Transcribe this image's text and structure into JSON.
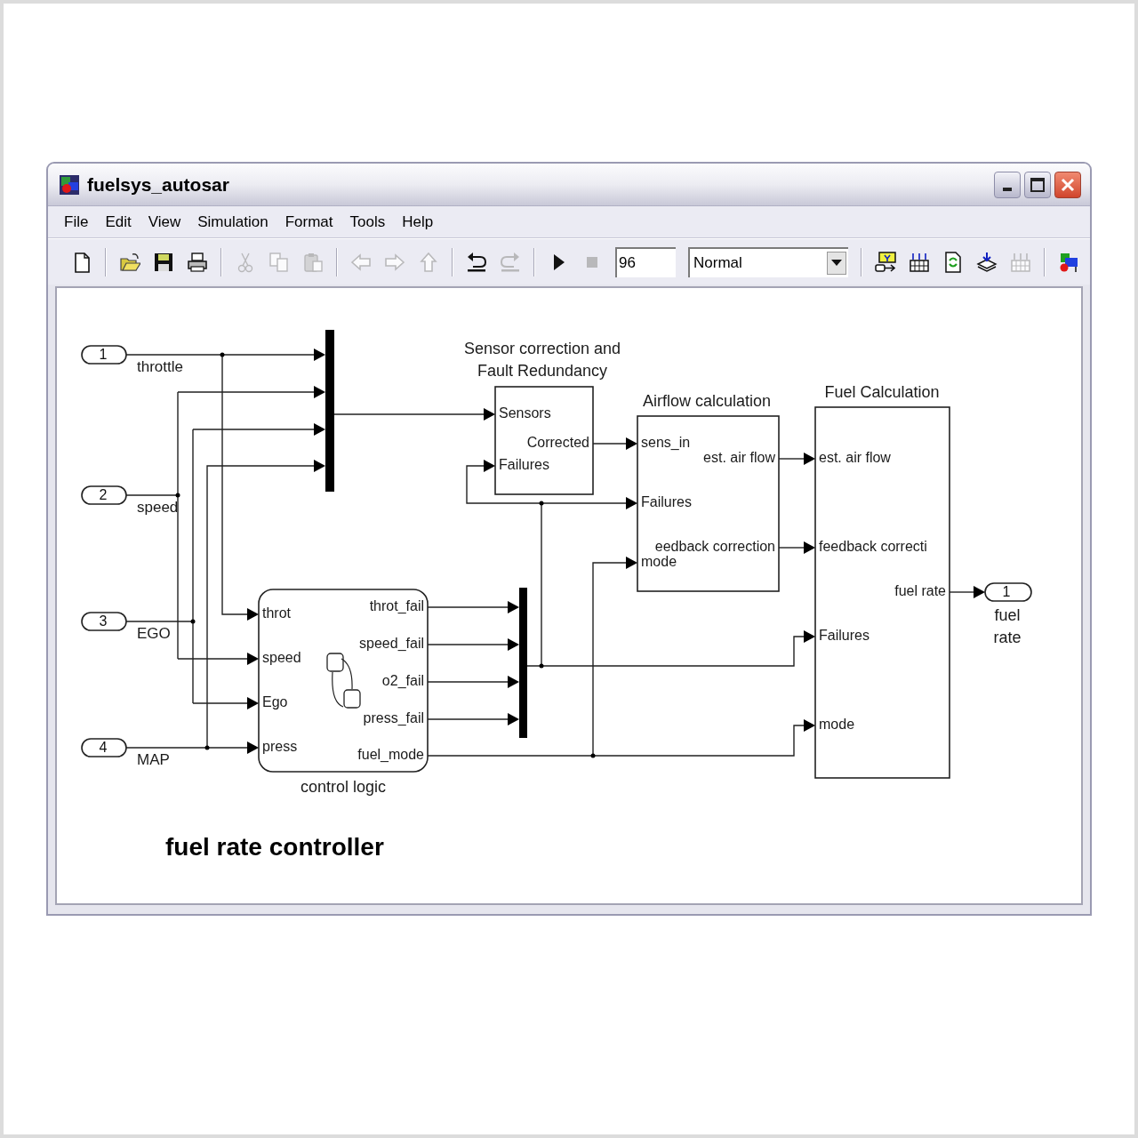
{
  "window": {
    "title": "fuelsys_autosar"
  },
  "menu": [
    "File",
    "Edit",
    "View",
    "Simulation",
    "Format",
    "Tools",
    "Help"
  ],
  "toolbar": [
    {
      "kind": "new",
      "disabled": false
    },
    {
      "kind": "separator"
    },
    {
      "kind": "open",
      "disabled": false
    },
    {
      "kind": "save",
      "disabled": false
    },
    {
      "kind": "print",
      "disabled": false
    },
    {
      "kind": "separator"
    },
    {
      "kind": "cut",
      "disabled": true
    },
    {
      "kind": "copy",
      "disabled": true
    },
    {
      "kind": "paste",
      "disabled": true
    },
    {
      "kind": "separator"
    },
    {
      "kind": "back",
      "disabled": true
    },
    {
      "kind": "forward",
      "disabled": true
    },
    {
      "kind": "up",
      "disabled": true
    },
    {
      "kind": "separator"
    },
    {
      "kind": "undo",
      "disabled": false
    },
    {
      "kind": "redo",
      "disabled": true
    },
    {
      "kind": "separator"
    },
    {
      "kind": "start",
      "disabled": false
    },
    {
      "kind": "stop",
      "disabled": true
    },
    {
      "kind": "stop_time",
      "value": "96"
    },
    {
      "kind": "mode",
      "value": "Normal"
    },
    {
      "kind": "separator"
    },
    {
      "kind": "explorer",
      "disabled": false
    },
    {
      "kind": "library",
      "disabled": false
    },
    {
      "kind": "refresh",
      "disabled": false
    },
    {
      "kind": "stack",
      "disabled": false
    },
    {
      "kind": "library",
      "disabled": true
    },
    {
      "kind": "separator"
    },
    {
      "kind": "debug",
      "disabled": false
    }
  ],
  "diagram": {
    "inports": [
      {
        "number": "1",
        "label": "throttle"
      },
      {
        "number": "2",
        "label": "speed"
      },
      {
        "number": "3",
        "label": "EGO"
      },
      {
        "number": "4",
        "label": "MAP"
      }
    ],
    "outports": [
      {
        "number": "1",
        "label_lines": [
          "fuel",
          "rate"
        ]
      }
    ],
    "blocks": [
      {
        "kind": "chart",
        "title_lines": [
          "control logic"
        ],
        "inputs": [
          "throt",
          "speed",
          "Ego",
          "press"
        ],
        "outputs": [
          "throt_fail",
          "speed_fail",
          "o2_fail",
          "press_fail",
          "fuel_mode"
        ]
      },
      {
        "kind": "subsystem",
        "title_lines": [
          "Sensor correction and",
          "Fault Redundancy"
        ],
        "inputs": [
          "Sensors",
          "Failures"
        ],
        "outputs": [
          "Corrected"
        ]
      },
      {
        "kind": "subsystem",
        "title_lines": [
          "Airflow calculation"
        ],
        "inputs": [
          "sens_in",
          "Failures",
          "mode"
        ],
        "outputs": [
          "est. air flow",
          "eedback correction"
        ]
      },
      {
        "kind": "subsystem",
        "title_lines": [
          "Fuel  Calculation"
        ],
        "inputs": [
          "est. air flow",
          "feedback correcti",
          "Failures",
          "mode"
        ],
        "outputs": [
          "fuel rate"
        ]
      }
    ],
    "caption": "fuel rate controller"
  }
}
